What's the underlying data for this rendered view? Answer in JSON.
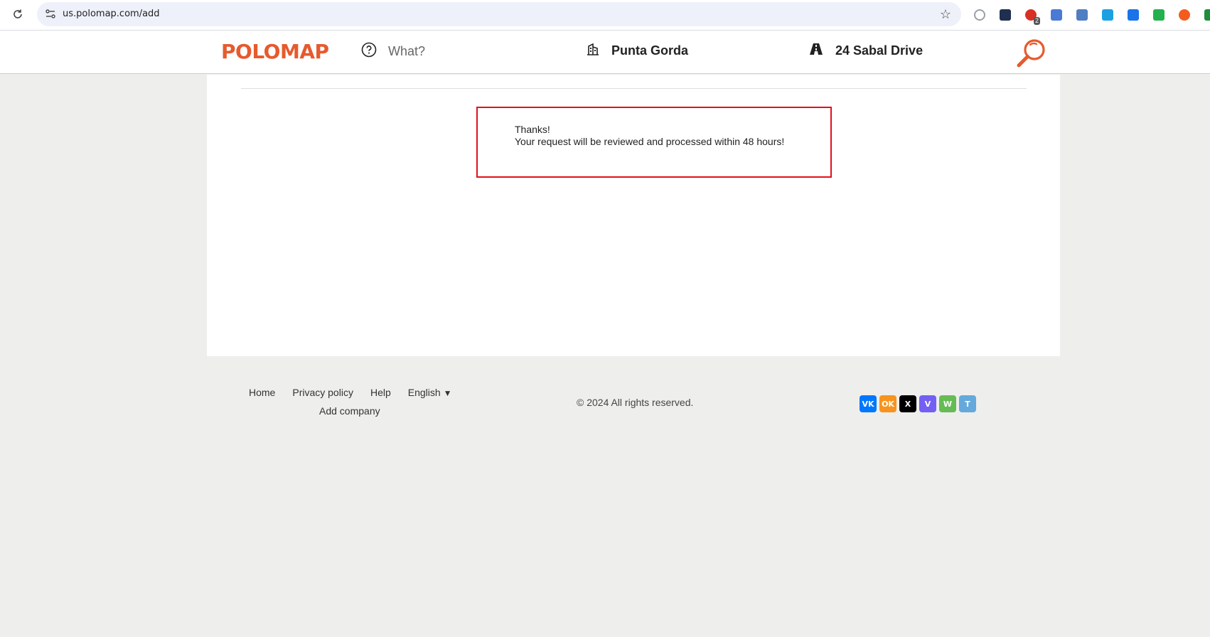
{
  "browser": {
    "url": "us.polomap.com/add",
    "extensions": [
      {
        "icon": "globe-icon",
        "color": "#9aa0a6"
      },
      {
        "icon": "folder-icon",
        "color": "#1f2f4f"
      },
      {
        "icon": "adblock-icon",
        "color": "#d93025",
        "badge": "2"
      },
      {
        "icon": "translate-icon",
        "color": "#4a7ad6"
      },
      {
        "icon": "mp-icon",
        "color": "#4f7fc2"
      },
      {
        "icon": "m-icon",
        "color": "#1ba1e2"
      },
      {
        "icon": "screenshot-icon",
        "color": "#1a73e8"
      },
      {
        "icon": "shield-check-icon",
        "color": "#23b14d"
      },
      {
        "icon": "fire-icon",
        "color": "#f25c1f"
      },
      {
        "icon": "green-ext-icon",
        "color": "#1e8e3e"
      }
    ]
  },
  "header": {
    "logo": "POLOMAP",
    "what_placeholder": "What?",
    "city": "Punta Gorda",
    "street": "24 Sabal Drive",
    "accent": "#e65a2d"
  },
  "notice": {
    "line1": "Thanks!",
    "line2": "Your request will be reviewed and processed within 48 hours!",
    "border_color": "#e2101b"
  },
  "footer": {
    "links": {
      "home": "Home",
      "privacy": "Privacy policy",
      "help": "Help",
      "language": "English",
      "language_arrow": "▼",
      "add_company": "Add company"
    },
    "copyright": "© 2024 All rights reserved.",
    "socials": [
      {
        "name": "vk-icon",
        "label": "VK",
        "color": "#0077ff"
      },
      {
        "name": "odnoklassniki-icon",
        "label": "OK",
        "color": "#f7931e"
      },
      {
        "name": "x-icon",
        "label": "X",
        "color": "#000000"
      },
      {
        "name": "viber-icon",
        "label": "V",
        "color": "#7360f2"
      },
      {
        "name": "whatsapp-icon",
        "label": "W",
        "color": "#65bc54"
      },
      {
        "name": "telegram-icon",
        "label": "T",
        "color": "#64a9dc"
      }
    ]
  }
}
